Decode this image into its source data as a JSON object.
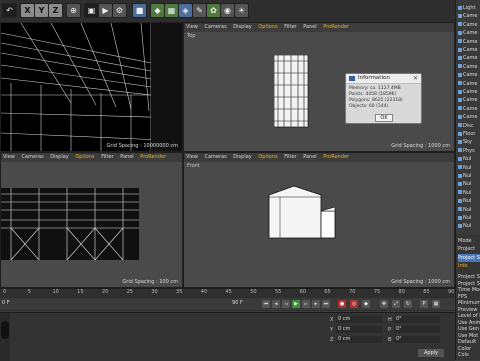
{
  "toolbar": {
    "axes": [
      "X",
      "Y",
      "Z"
    ],
    "icons": [
      "undo-icon",
      "redo-icon",
      "select-icon",
      "move-icon",
      "scale-icon",
      "rotate-icon",
      "axis-x-icon",
      "axis-y-icon",
      "axis-z-icon",
      "world-icon",
      "render-view-icon",
      "render-icon",
      "render-settings-icon",
      "cube-icon",
      "pen-icon",
      "subdivide-icon",
      "array-icon",
      "deformer-icon",
      "scene-icon",
      "camera-icon",
      "light-icon"
    ]
  },
  "viewports": {
    "top_left": {
      "menu": [
        "View",
        "Cameras",
        "Display",
        "Options",
        "Filter",
        "Panel",
        "ProRender"
      ],
      "grid": "Grid Spacing : 10000000 cm"
    },
    "top_right": {
      "menu": [
        "View",
        "Cameras",
        "Display",
        "Options",
        "Filter",
        "Panel",
        "ProRender"
      ],
      "label": "Top",
      "grid": "Grid Spacing : 1000 cm"
    },
    "bottom_left": {
      "menu": [
        "View",
        "Cameras",
        "Display",
        "Options",
        "Filter",
        "Panel",
        "ProRender"
      ],
      "grid": "Grid Spacing : 100 cm"
    },
    "bottom_right": {
      "menu": [
        "View",
        "Cameras",
        "Display",
        "Options",
        "Filter",
        "Panel",
        "ProRender"
      ],
      "label": "Front",
      "grid": "Grid Spacing : 1000 cm"
    }
  },
  "dialog": {
    "title": "Information",
    "lines": [
      "Memory: ca. 1127.4MB",
      "Points: 4458 (18596)",
      "Polygons: 8625 (22318)",
      "Objects: 60 (144)"
    ],
    "ok_label": "OK"
  },
  "object_manager": {
    "items": [
      "Light",
      "Came",
      "Came",
      "Came",
      "Came",
      "Came",
      "Came",
      "Came",
      "Came",
      "Came",
      "Came",
      "Came",
      "Came",
      "Came",
      "Disc",
      "Floor",
      "Sky",
      "Phys",
      "Nul",
      "Nul",
      "Nul",
      "Nul",
      "Nul",
      "Nul",
      "Nul",
      "Nul",
      "Nul"
    ]
  },
  "attributes": {
    "mode_label": "Mode",
    "project_label": "Project",
    "tab_active": "Project Settings",
    "tab_info": "Info",
    "rows": [
      "Project Settin",
      "Project Scale",
      "Time Mode",
      "FPS",
      "Minimum",
      "Preview",
      "Level of D",
      "Use Anim",
      "Use Gen",
      "Use Mot",
      "Default",
      "Color",
      "Cols"
    ]
  },
  "timeline": {
    "ticks": [
      "0",
      "5",
      "10",
      "15",
      "20",
      "25",
      "30",
      "35",
      "40",
      "45",
      "50",
      "55",
      "60",
      "65",
      "70",
      "75",
      "80",
      "85",
      "90"
    ],
    "current_frame": "0 F",
    "end_frame": "90 F"
  },
  "bottom": {
    "apply_label": "Apply",
    "fields": [
      "X",
      "Y",
      "Z",
      "H",
      "P",
      "B"
    ],
    "values": [
      "0 cm",
      "0 cm",
      "0 cm",
      "0°",
      "0°",
      "0°"
    ]
  }
}
